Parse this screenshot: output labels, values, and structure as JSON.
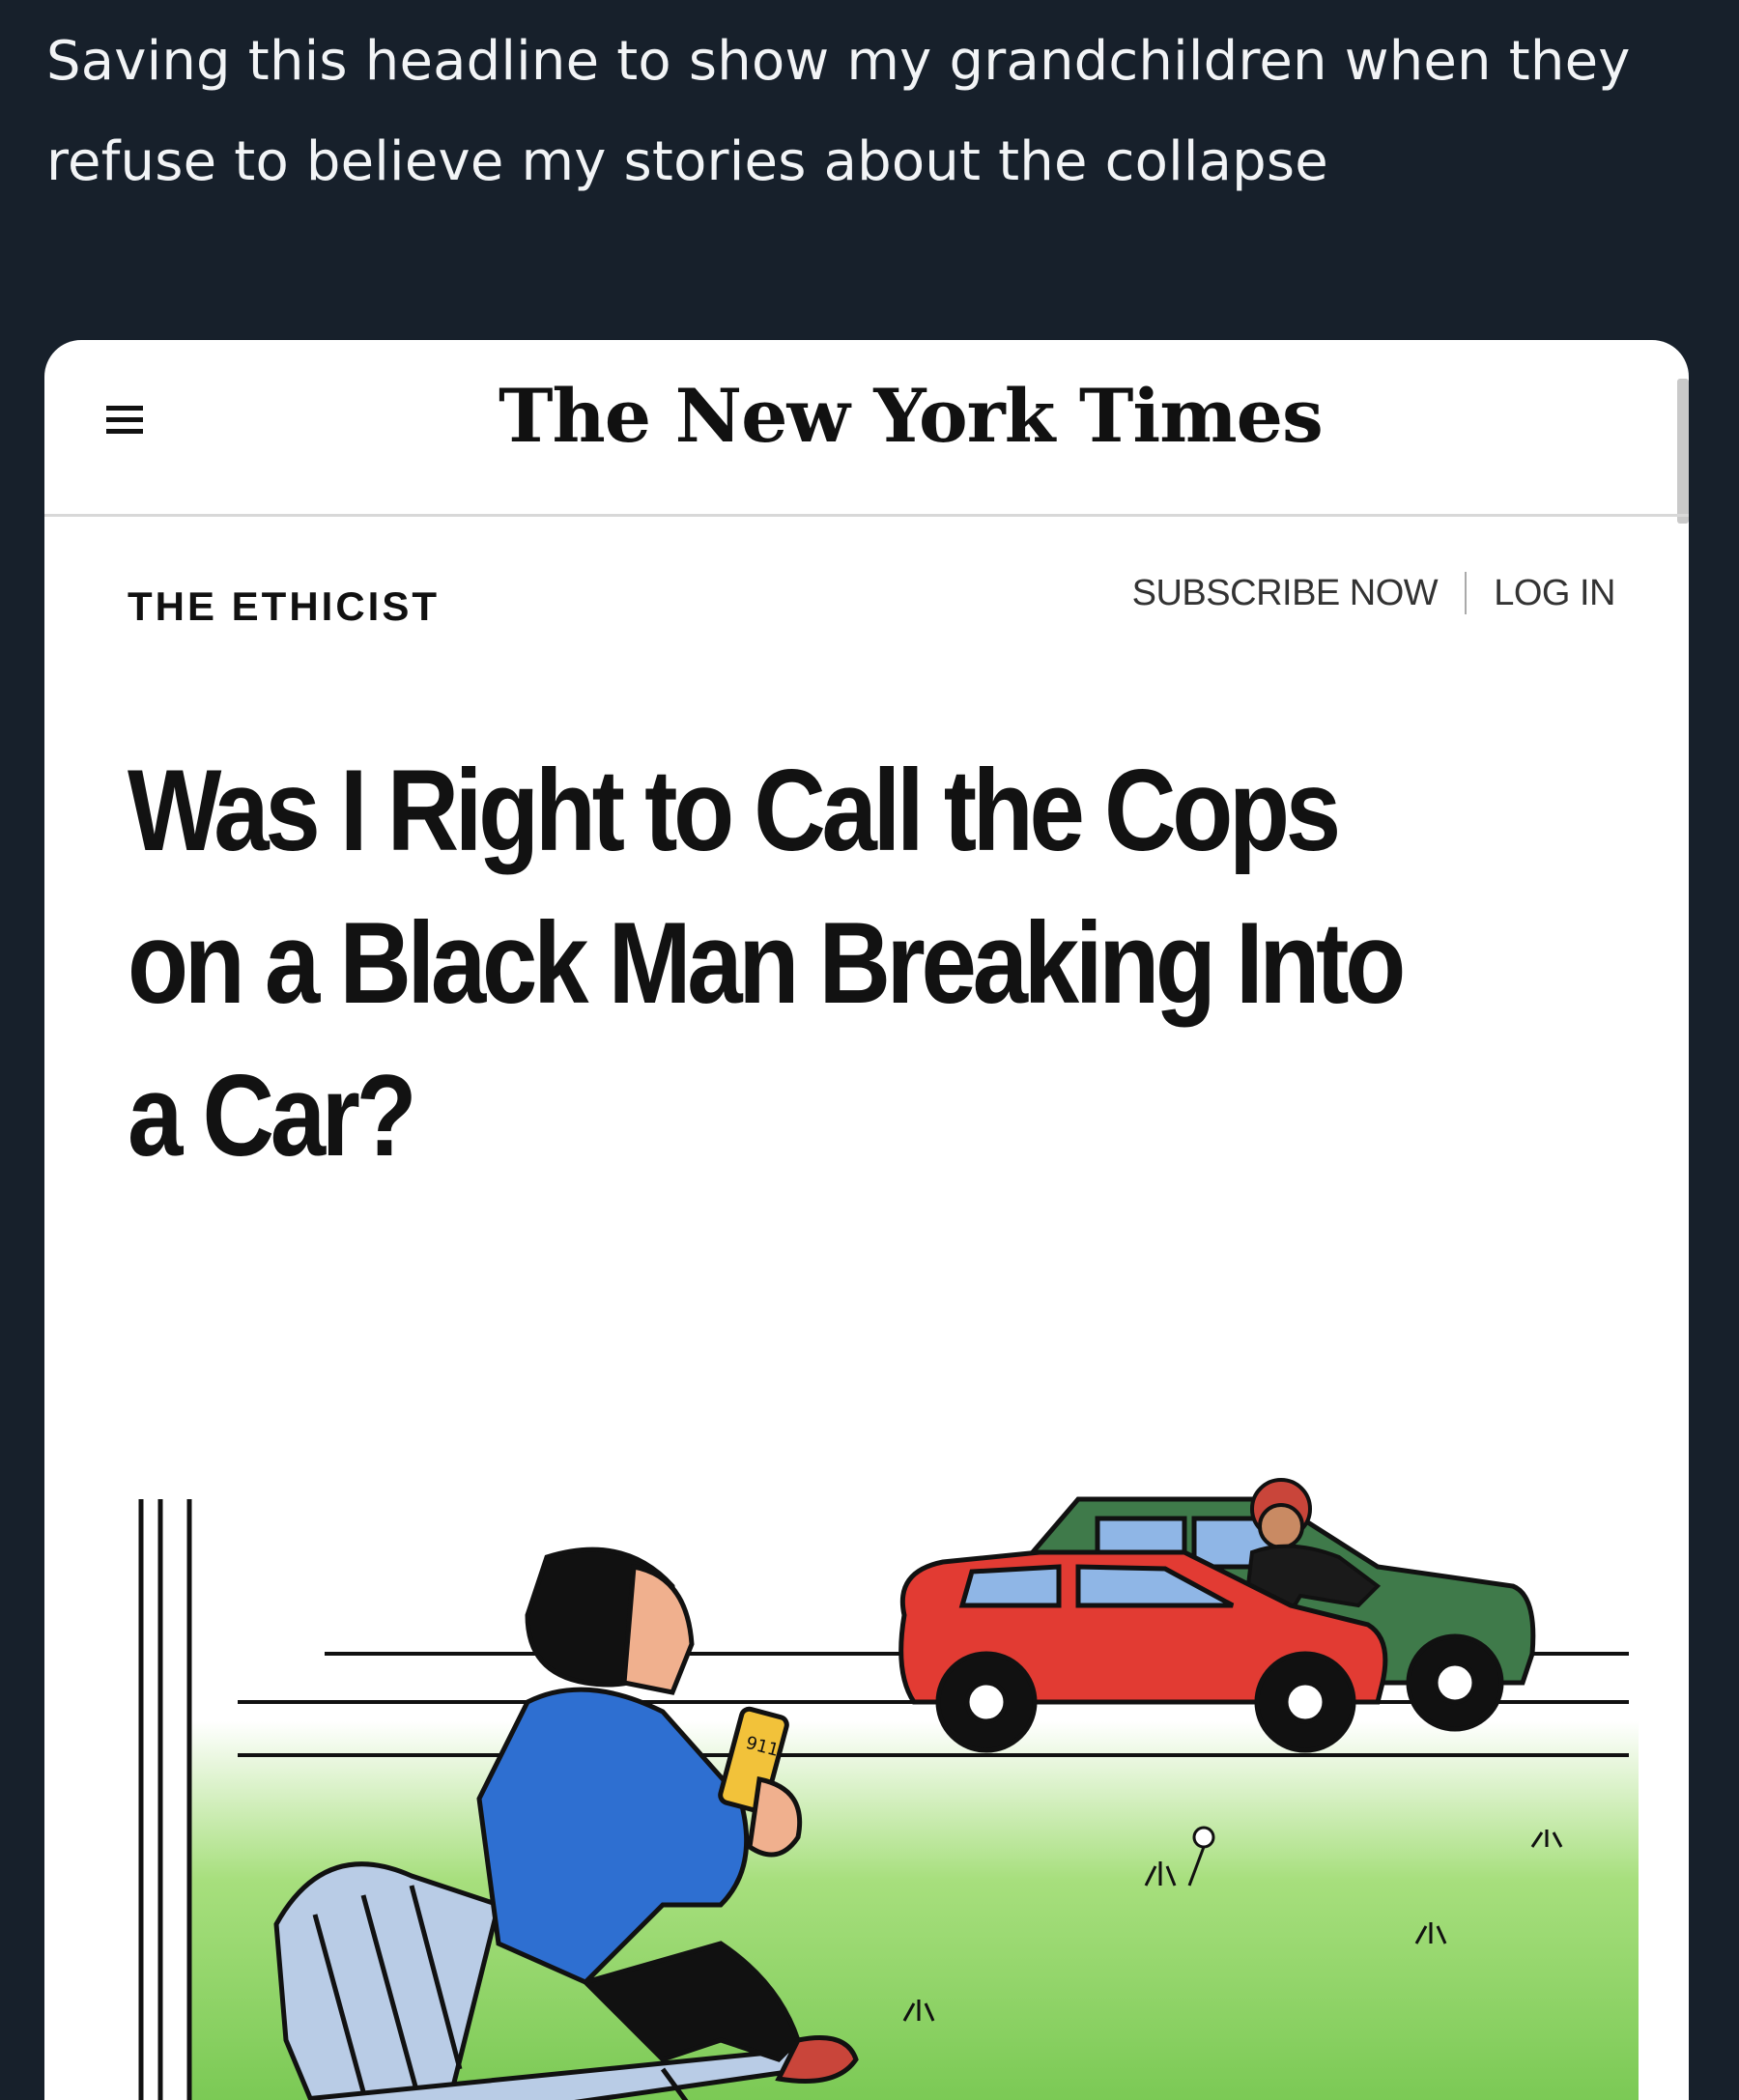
{
  "tweet": {
    "text": "Saving this headline to show my grandchildren when they refuse to believe my stories about the collapse"
  },
  "article": {
    "masthead": "The New York Times",
    "section": "THE ETHICIST",
    "subscribe_label": "SUBSCRIBE NOW",
    "login_label": "LOG IN",
    "headline": "Was I Right to Call the Cops on a Black Man Breaking Into a Car?"
  },
  "illustration": {
    "phone_text": "911",
    "colors": {
      "red_car": "#e23b33",
      "green_car": "#3f7a4a",
      "shirt": "#2e6fd1",
      "chair": "#b9cce6",
      "grass": "#77c94a",
      "skin": "#f0b08e",
      "phone": "#f2c23a"
    }
  },
  "icons": [
    "hamburger-menu-icon"
  ]
}
